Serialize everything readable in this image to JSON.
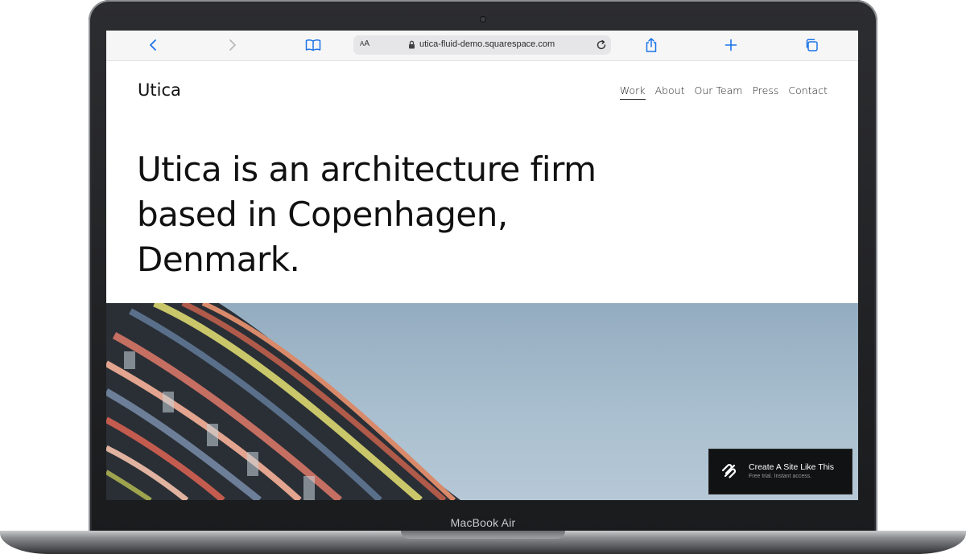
{
  "device": {
    "label": "MacBook Air"
  },
  "browser": {
    "text_size_label_small": "A",
    "text_size_label_large": "A",
    "url": "utica-fluid-demo.squarespace.com",
    "icons": [
      "chevron-left-icon",
      "chevron-right-icon",
      "book-icon",
      "lock-icon",
      "reload-icon",
      "share-icon",
      "plus-icon",
      "tabs-icon"
    ],
    "accent_color": "#1a73e8"
  },
  "site": {
    "title": "Utica",
    "nav": [
      {
        "label": "Work",
        "active": true
      },
      {
        "label": "About",
        "active": false
      },
      {
        "label": "Our Team",
        "active": false
      },
      {
        "label": "Press",
        "active": false
      },
      {
        "label": "Contact",
        "active": false
      }
    ],
    "hero_heading": "Utica is an architecture firm based in Copenhagen, Denmark.",
    "hero_image": "colorful-building-facade-against-sky"
  },
  "cta": {
    "title": "Create A Site Like This",
    "subtitle": "Free trial. Instant access.",
    "icon": "squarespace-logo-icon"
  }
}
